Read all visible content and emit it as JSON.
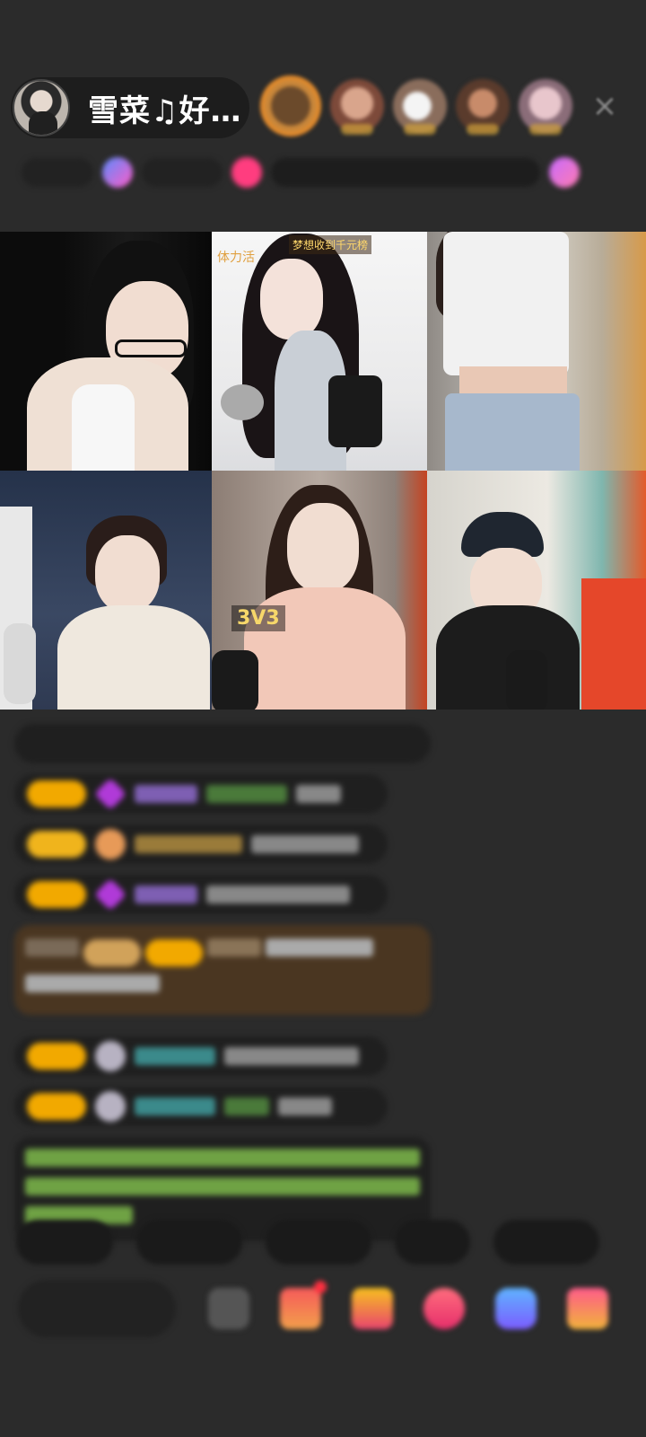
{
  "host": {
    "name": "雪菜♫好…",
    "avatar": "host-avatar"
  },
  "header": {
    "close_icon": "×"
  },
  "grid": {
    "cells": [
      {
        "label": "",
        "badge": ""
      },
      {
        "label": "体力活",
        "badge": "梦想收到千元榜"
      },
      {
        "label": "",
        "badge": ""
      },
      {
        "label": "",
        "badge": ""
      },
      {
        "label": "3V3",
        "badge": ""
      },
      {
        "label": "",
        "badge": ""
      }
    ]
  },
  "colors": {
    "background": "#2b2b2b",
    "badge_gold": "#f2a900",
    "system_text": "#8fce55",
    "highlight_msg_bg": "#4a3621"
  }
}
